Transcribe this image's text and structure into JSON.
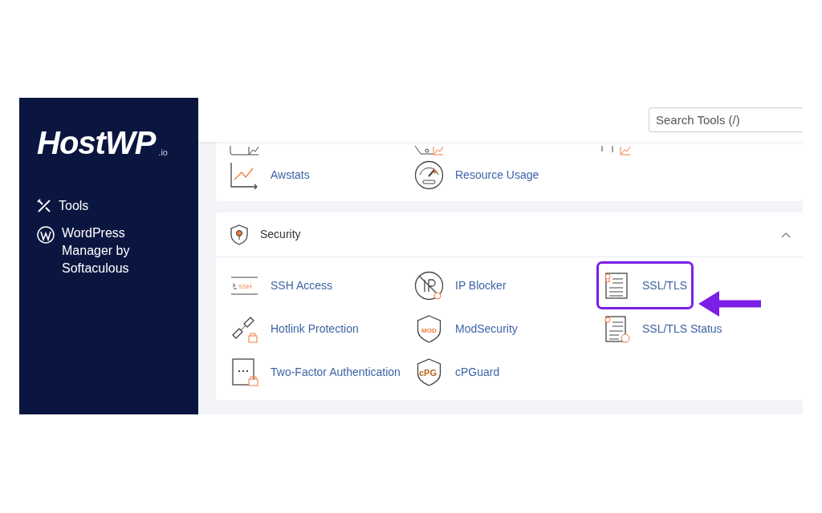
{
  "sidebar": {
    "logo": {
      "name": "HostWP",
      "suffix": ".io"
    },
    "items": [
      {
        "label": "Tools"
      },
      {
        "label": "WordPress Manager by Softaculous"
      }
    ]
  },
  "search": {
    "placeholder": "Search Tools (/)"
  },
  "stats_section": {
    "tools": [
      {
        "label": "Awstats",
        "highlighted": false
      },
      {
        "label": "Resource Usage",
        "highlighted": false
      }
    ]
  },
  "security_section": {
    "title": "Security",
    "expanded": true,
    "tools": [
      {
        "label": "SSH Access",
        "icon_text": "SSH",
        "highlighted": false
      },
      {
        "label": "IP Blocker",
        "highlighted": false
      },
      {
        "label": "SSL/TLS",
        "highlighted": true
      },
      {
        "label": "Hotlink Protection",
        "highlighted": false
      },
      {
        "label": "ModSecurity",
        "icon_text": "MOD",
        "highlighted": false
      },
      {
        "label": "SSL/TLS Status",
        "highlighted": false
      },
      {
        "label": "Two-Factor Authentication",
        "highlighted": false
      },
      {
        "label": "cPGuard",
        "icon_text": "cPG",
        "highlighted": false
      }
    ]
  }
}
